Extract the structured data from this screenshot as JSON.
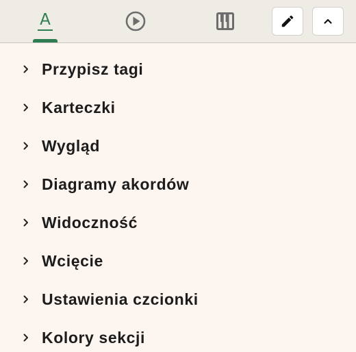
{
  "tabs": [
    {
      "icon": "text-format-icon",
      "glyph": "A",
      "active": true
    },
    {
      "icon": "play-circle-icon",
      "active": false
    },
    {
      "icon": "piano-icon",
      "active": false
    }
  ],
  "toolbar": {
    "edit_icon": "pencil-icon",
    "collapse_icon": "chevron-up-icon"
  },
  "colors": {
    "accent": "#2e7d52",
    "background": "#fdf5ef",
    "tabbar": "#efebe5"
  },
  "menu": {
    "items": [
      {
        "label": "Przypisz tagi"
      },
      {
        "label": "Karteczki"
      },
      {
        "label": "Wygląd"
      },
      {
        "label": "Diagramy akordów"
      },
      {
        "label": "Widoczność"
      },
      {
        "label": "Wcięcie"
      },
      {
        "label": "Ustawienia czcionki"
      },
      {
        "label": "Kolory sekcji"
      }
    ]
  }
}
